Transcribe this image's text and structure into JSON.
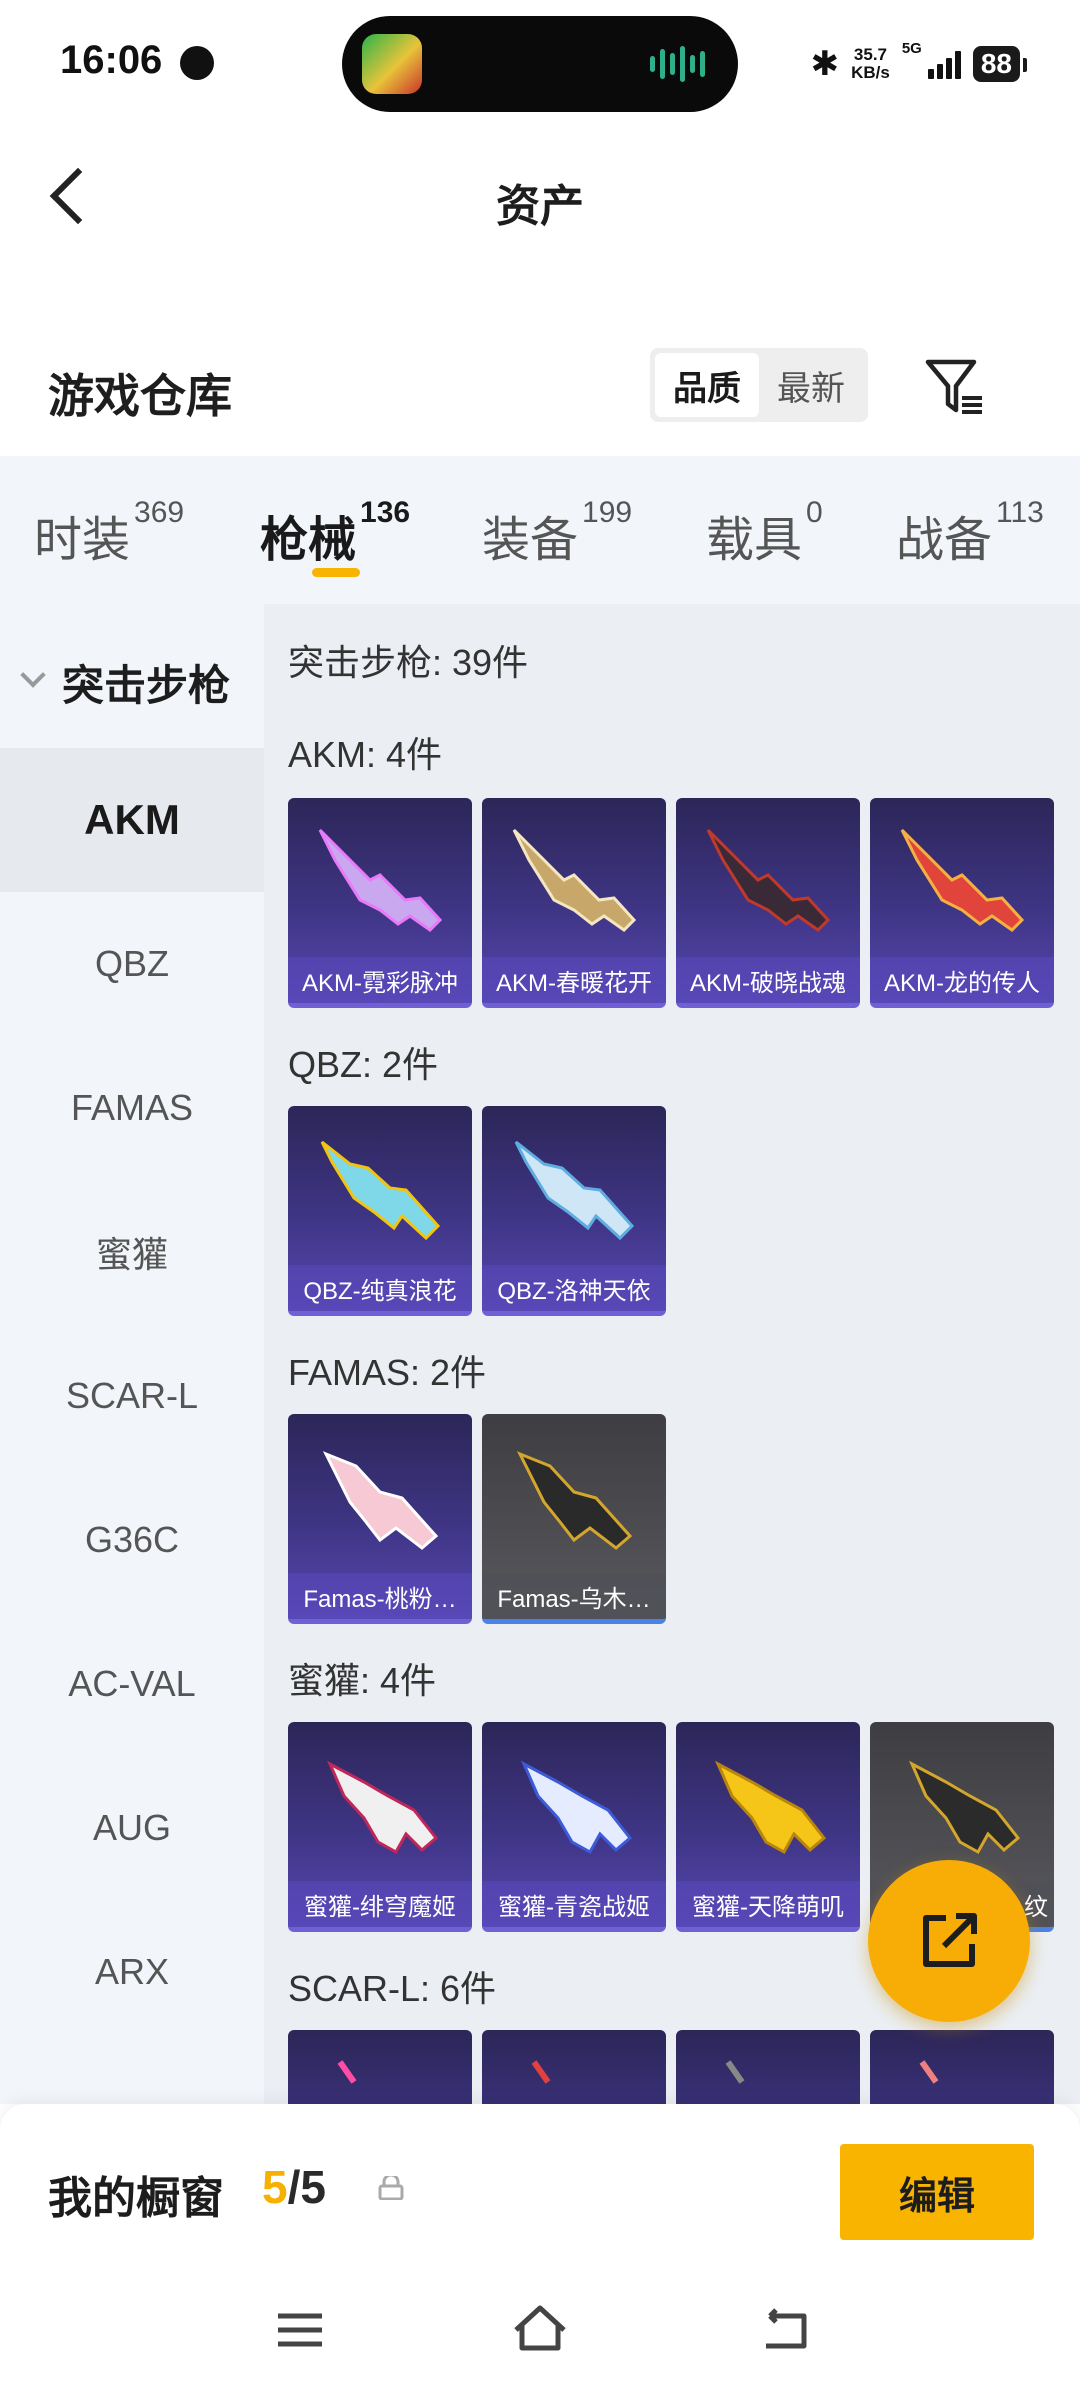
{
  "status_bar": {
    "time": "16:06",
    "net_speed_value": "35.7",
    "net_speed_unit": "KB/s",
    "network": "5G",
    "battery": "88"
  },
  "header": {
    "title": "资产",
    "section_title": "游戏仓库",
    "sort_options": [
      "品质",
      "最新"
    ],
    "active_sort": "品质"
  },
  "tabs": [
    {
      "label": "时装",
      "count": "369"
    },
    {
      "label": "枪械",
      "count": "136"
    },
    {
      "label": "装备",
      "count": "199"
    },
    {
      "label": "载具",
      "count": "0"
    },
    {
      "label": "战备",
      "count": "113"
    }
  ],
  "active_tab": "枪械",
  "sidebar": {
    "category": "突击步枪",
    "items": [
      "AKM",
      "QBZ",
      "FAMAS",
      "蜜獾",
      "SCAR-L",
      "G36C",
      "AC-VAL",
      "AUG",
      "ARX"
    ],
    "active": "AKM"
  },
  "content": {
    "title": "突击步枪: 39件",
    "groups": [
      {
        "title": "AKM: 4件",
        "items": [
          {
            "name": "AKM-霓彩脉冲",
            "quality": "purple"
          },
          {
            "name": "AKM-春暖花开",
            "quality": "purple"
          },
          {
            "name": "AKM-破晓战魂",
            "quality": "purple"
          },
          {
            "name": "AKM-龙的传人",
            "quality": "purple"
          }
        ]
      },
      {
        "title": "QBZ: 2件",
        "items": [
          {
            "name": "QBZ-纯真浪花",
            "quality": "purple"
          },
          {
            "name": "QBZ-洛神天依",
            "quality": "purple"
          }
        ]
      },
      {
        "title": "FAMAS: 2件",
        "items": [
          {
            "name": "Famas-桃粉…",
            "quality": "purple"
          },
          {
            "name": "Famas-乌木…",
            "quality": "grey"
          }
        ]
      },
      {
        "title": "蜜獾: 4件",
        "items": [
          {
            "name": "蜜獾-绯穹魔姬",
            "quality": "purple"
          },
          {
            "name": "蜜獾-青瓷战姬",
            "quality": "purple"
          },
          {
            "name": "蜜獾-天降萌叽",
            "quality": "purple"
          },
          {
            "name": "纹",
            "quality": "grey"
          }
        ]
      },
      {
        "title": "SCAR-L: 6件",
        "items": [
          {
            "name": "",
            "quality": "purple"
          },
          {
            "name": "",
            "quality": "purple"
          },
          {
            "name": "",
            "quality": "purple"
          },
          {
            "name": "",
            "quality": "purple"
          }
        ]
      }
    ]
  },
  "bottom": {
    "label": "我的橱窗",
    "count_current": "5",
    "count_total": "/5",
    "edit_label": "编辑"
  },
  "icons": {
    "back": "chevron-left-icon",
    "filter": "filter-list-icon",
    "share": "external-share-icon",
    "lock": "lock-icon",
    "nav_menu": "menu-icon",
    "nav_home": "home-icon",
    "nav_back": "back-arrow-icon"
  },
  "colors": {
    "accent": "#f7b400",
    "card_purple": "#3f3585",
    "card_grey": "#4d4d52"
  }
}
